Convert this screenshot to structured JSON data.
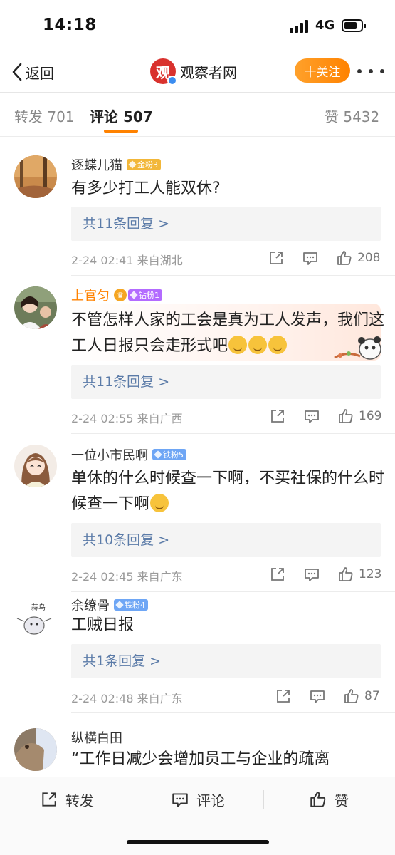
{
  "status_bar": {
    "time": "14:18",
    "network": "4G"
  },
  "nav": {
    "back_label": "返回",
    "logo_char": "观",
    "title": "观察者网",
    "follow_label": "十关注"
  },
  "tabs": {
    "repost": "转发 701",
    "comment": "评论 507",
    "like": "赞 5432"
  },
  "comments": [
    {
      "username": "逐蝶儿猫",
      "badge": "金粉3",
      "text": "有多少打工人能双休?",
      "replies": "共11条回复 >",
      "meta": "2-24 02:41  来自湖北",
      "likes": "208"
    },
    {
      "username": "上官匀",
      "badge": "钻粉1",
      "text": "不管怎样人家的工会是真为工人发声，我们这工人日报只会走形式吧",
      "replies": "共11条回复 >",
      "meta": "2-24 02:55  来自广西",
      "likes": "169"
    },
    {
      "username": "一位小市民啊",
      "badge": "铁粉5",
      "text": "单休的什么时候查一下啊，不买社保的什么时候查一下啊",
      "replies": "共10条回复 >",
      "meta": "2-24 02:45  来自广东",
      "likes": "123"
    },
    {
      "username": "余缭骨",
      "badge": "铁粉4",
      "avatar_text": "蒜鸟",
      "text": "工贼日报",
      "replies": "共1条回复 >",
      "meta": "2-24 02:48  来自广东",
      "likes": "87"
    },
    {
      "username": "纵横白田",
      "text": "“工作日减少会增加员工与企业的疏离"
    }
  ],
  "bottom_bar": {
    "repost": "转发",
    "comment": "评论",
    "like": "赞"
  },
  "colors": {
    "accent": "#ff8200",
    "link": "#5b7ba8",
    "brand_red": "#d9322e"
  }
}
